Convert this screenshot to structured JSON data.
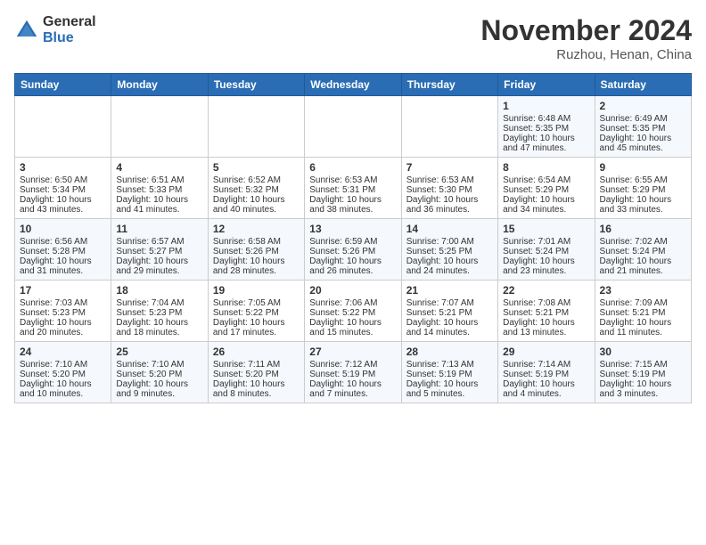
{
  "logo": {
    "general": "General",
    "blue": "Blue"
  },
  "title": "November 2024",
  "subtitle": "Ruzhou, Henan, China",
  "weekdays": [
    "Sunday",
    "Monday",
    "Tuesday",
    "Wednesday",
    "Thursday",
    "Friday",
    "Saturday"
  ],
  "weeks": [
    [
      {
        "day": "",
        "info": ""
      },
      {
        "day": "",
        "info": ""
      },
      {
        "day": "",
        "info": ""
      },
      {
        "day": "",
        "info": ""
      },
      {
        "day": "",
        "info": ""
      },
      {
        "day": "1",
        "info": "Sunrise: 6:48 AM\nSunset: 5:35 PM\nDaylight: 10 hours\nand 47 minutes."
      },
      {
        "day": "2",
        "info": "Sunrise: 6:49 AM\nSunset: 5:35 PM\nDaylight: 10 hours\nand 45 minutes."
      }
    ],
    [
      {
        "day": "3",
        "info": "Sunrise: 6:50 AM\nSunset: 5:34 PM\nDaylight: 10 hours\nand 43 minutes."
      },
      {
        "day": "4",
        "info": "Sunrise: 6:51 AM\nSunset: 5:33 PM\nDaylight: 10 hours\nand 41 minutes."
      },
      {
        "day": "5",
        "info": "Sunrise: 6:52 AM\nSunset: 5:32 PM\nDaylight: 10 hours\nand 40 minutes."
      },
      {
        "day": "6",
        "info": "Sunrise: 6:53 AM\nSunset: 5:31 PM\nDaylight: 10 hours\nand 38 minutes."
      },
      {
        "day": "7",
        "info": "Sunrise: 6:53 AM\nSunset: 5:30 PM\nDaylight: 10 hours\nand 36 minutes."
      },
      {
        "day": "8",
        "info": "Sunrise: 6:54 AM\nSunset: 5:29 PM\nDaylight: 10 hours\nand 34 minutes."
      },
      {
        "day": "9",
        "info": "Sunrise: 6:55 AM\nSunset: 5:29 PM\nDaylight: 10 hours\nand 33 minutes."
      }
    ],
    [
      {
        "day": "10",
        "info": "Sunrise: 6:56 AM\nSunset: 5:28 PM\nDaylight: 10 hours\nand 31 minutes."
      },
      {
        "day": "11",
        "info": "Sunrise: 6:57 AM\nSunset: 5:27 PM\nDaylight: 10 hours\nand 29 minutes."
      },
      {
        "day": "12",
        "info": "Sunrise: 6:58 AM\nSunset: 5:26 PM\nDaylight: 10 hours\nand 28 minutes."
      },
      {
        "day": "13",
        "info": "Sunrise: 6:59 AM\nSunset: 5:26 PM\nDaylight: 10 hours\nand 26 minutes."
      },
      {
        "day": "14",
        "info": "Sunrise: 7:00 AM\nSunset: 5:25 PM\nDaylight: 10 hours\nand 24 minutes."
      },
      {
        "day": "15",
        "info": "Sunrise: 7:01 AM\nSunset: 5:24 PM\nDaylight: 10 hours\nand 23 minutes."
      },
      {
        "day": "16",
        "info": "Sunrise: 7:02 AM\nSunset: 5:24 PM\nDaylight: 10 hours\nand 21 minutes."
      }
    ],
    [
      {
        "day": "17",
        "info": "Sunrise: 7:03 AM\nSunset: 5:23 PM\nDaylight: 10 hours\nand 20 minutes."
      },
      {
        "day": "18",
        "info": "Sunrise: 7:04 AM\nSunset: 5:23 PM\nDaylight: 10 hours\nand 18 minutes."
      },
      {
        "day": "19",
        "info": "Sunrise: 7:05 AM\nSunset: 5:22 PM\nDaylight: 10 hours\nand 17 minutes."
      },
      {
        "day": "20",
        "info": "Sunrise: 7:06 AM\nSunset: 5:22 PM\nDaylight: 10 hours\nand 15 minutes."
      },
      {
        "day": "21",
        "info": "Sunrise: 7:07 AM\nSunset: 5:21 PM\nDaylight: 10 hours\nand 14 minutes."
      },
      {
        "day": "22",
        "info": "Sunrise: 7:08 AM\nSunset: 5:21 PM\nDaylight: 10 hours\nand 13 minutes."
      },
      {
        "day": "23",
        "info": "Sunrise: 7:09 AM\nSunset: 5:21 PM\nDaylight: 10 hours\nand 11 minutes."
      }
    ],
    [
      {
        "day": "24",
        "info": "Sunrise: 7:10 AM\nSunset: 5:20 PM\nDaylight: 10 hours\nand 10 minutes."
      },
      {
        "day": "25",
        "info": "Sunrise: 7:10 AM\nSunset: 5:20 PM\nDaylight: 10 hours\nand 9 minutes."
      },
      {
        "day": "26",
        "info": "Sunrise: 7:11 AM\nSunset: 5:20 PM\nDaylight: 10 hours\nand 8 minutes."
      },
      {
        "day": "27",
        "info": "Sunrise: 7:12 AM\nSunset: 5:19 PM\nDaylight: 10 hours\nand 7 minutes."
      },
      {
        "day": "28",
        "info": "Sunrise: 7:13 AM\nSunset: 5:19 PM\nDaylight: 10 hours\nand 5 minutes."
      },
      {
        "day": "29",
        "info": "Sunrise: 7:14 AM\nSunset: 5:19 PM\nDaylight: 10 hours\nand 4 minutes."
      },
      {
        "day": "30",
        "info": "Sunrise: 7:15 AM\nSunset: 5:19 PM\nDaylight: 10 hours\nand 3 minutes."
      }
    ]
  ]
}
